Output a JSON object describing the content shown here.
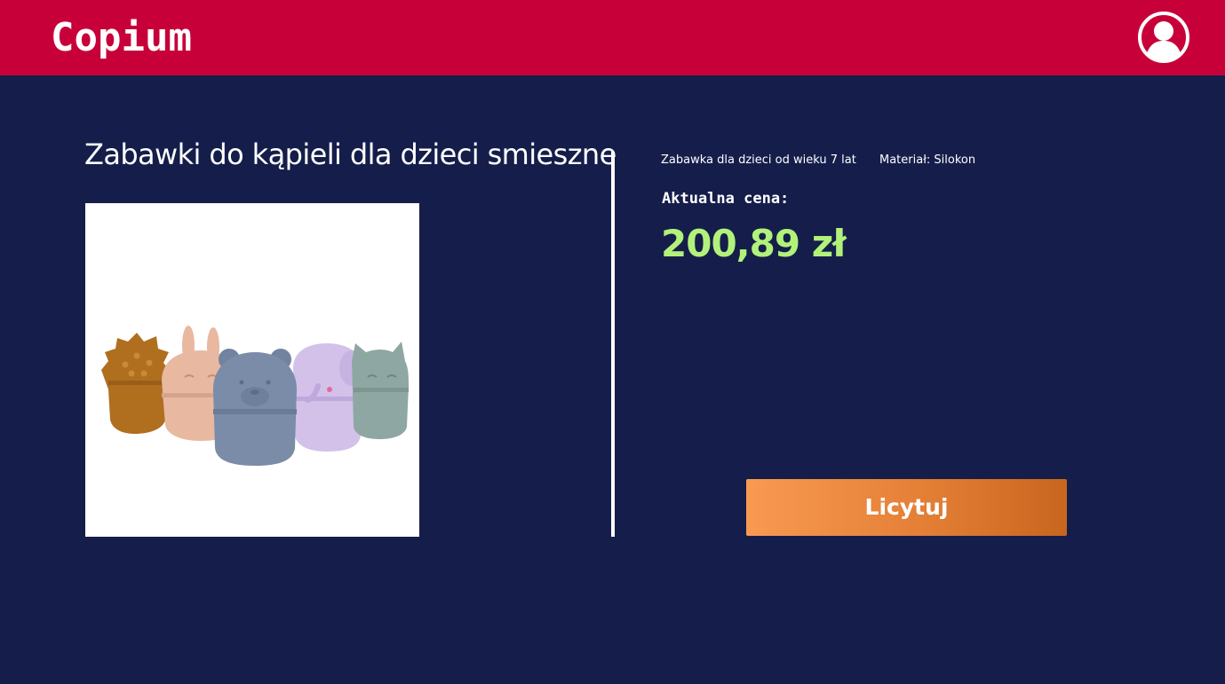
{
  "header": {
    "logo": "Copium",
    "avatar_icon": "user-circle-icon",
    "background_color": "#c8003a"
  },
  "product": {
    "title": "Zabawki do kąpieli dla dzieci smieszne",
    "image_alt": "silicone-animal-bath-toys",
    "attributes": {
      "age": "Zabawka dla dzieci od wieku 7 lat",
      "material": "Materiał: Silokon"
    },
    "price_label": "Aktualna cena:",
    "price_value": "200,89 zł",
    "price_color": "#b2f27a"
  },
  "actions": {
    "bid_label": "Licytuj"
  },
  "theme": {
    "page_background": "#151e4a",
    "button_gradient": [
      "#f99a52",
      "#c8651e"
    ]
  }
}
